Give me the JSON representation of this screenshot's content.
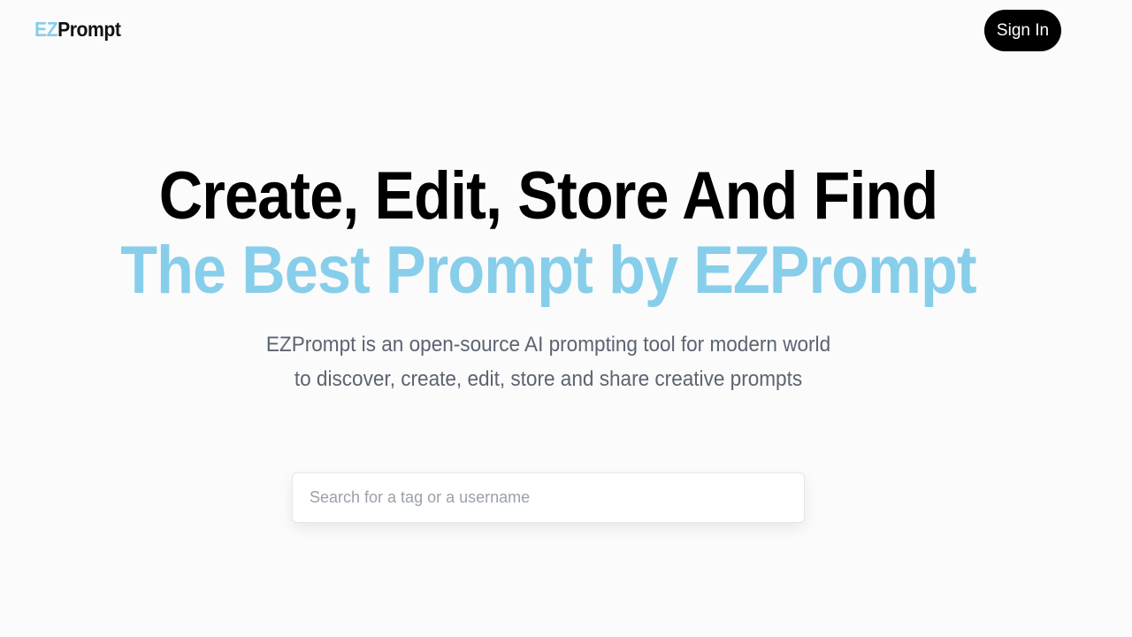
{
  "header": {
    "logo_ez": "EZ",
    "logo_rest": "Prompt",
    "signin_label": "Sign In"
  },
  "hero": {
    "line1": "Create, Edit, Store And Find",
    "line2": "The Best Prompt by EZPrompt",
    "subtitle": "EZPrompt is an open-source AI prompting tool for modern world to discover, create, edit, store and share creative prompts"
  },
  "search": {
    "placeholder": "Search for a tag or a username",
    "value": ""
  },
  "colors": {
    "accent": "#87ceeb",
    "button_bg": "#000000",
    "background": "#fbfbfb"
  }
}
